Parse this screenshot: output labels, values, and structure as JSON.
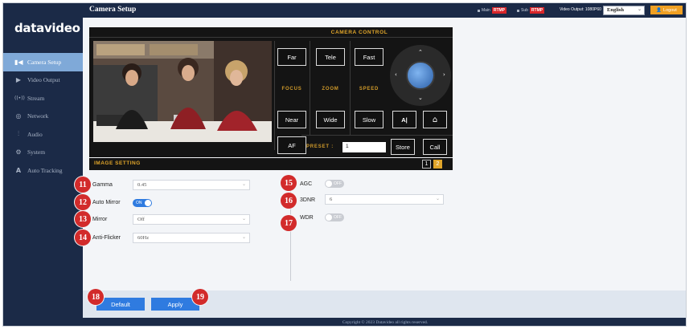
{
  "brand": {
    "logo_text": "datavideo"
  },
  "sidebar": {
    "items": [
      {
        "icon": "camera-icon",
        "glyph": "▮◀",
        "label": "Camera Setup",
        "active": true
      },
      {
        "icon": "video-output-icon",
        "glyph": "▶",
        "label": "Video Output",
        "active": false
      },
      {
        "icon": "stream-icon",
        "glyph": "((•))",
        "label": "Stream",
        "active": false
      },
      {
        "icon": "network-icon",
        "glyph": "◎",
        "label": "Network",
        "active": false
      },
      {
        "icon": "audio-icon",
        "glyph": "⫶",
        "label": "Audio",
        "active": false
      },
      {
        "icon": "system-icon",
        "glyph": "⚙",
        "label": "System",
        "active": false
      },
      {
        "icon": "auto-tracking-icon",
        "glyph": "A",
        "label": "Auto Tracking",
        "active": false
      }
    ]
  },
  "header": {
    "title": "Camera Setup",
    "main_label": "Main",
    "main_badge": "RTMP",
    "sub_label": "Sub",
    "sub_badge": "RTMP",
    "video_output": "Video Output: 1080P60",
    "language": "English",
    "logout": "Logout"
  },
  "camera_control": {
    "title": "CAMERA CONTROL",
    "focus": {
      "far": "Far",
      "label": "FOCUS",
      "near": "Near"
    },
    "zoom": {
      "tele": "Tele",
      "label": "ZOOM",
      "wide": "Wide"
    },
    "speed": {
      "fast": "Fast",
      "label": "SPEED",
      "slow": "Slow"
    },
    "af": "AF",
    "auto_tracking": "A|",
    "home": "⌂",
    "preset_label": "PRESET :",
    "preset_value": "1",
    "store": "Store",
    "call": "Call"
  },
  "image_setting": {
    "title": "IMAGE SETTING",
    "pages": [
      "1",
      "2"
    ],
    "active_page": "2",
    "gamma": {
      "label": "Gamma",
      "value": "0.45"
    },
    "auto_mirror": {
      "label": "Auto Mirror",
      "state": "ON"
    },
    "mirror": {
      "label": "Mirror",
      "value": "Off"
    },
    "anti_flicker": {
      "label": "Anti-Flicker",
      "value": "60Hz"
    },
    "agc": {
      "label": "AGC",
      "state": "OFF"
    },
    "dnr": {
      "label": "3DNR",
      "value": "6"
    },
    "wdr": {
      "label": "WDR",
      "state": "OFF"
    }
  },
  "callouts": [
    "11",
    "12",
    "13",
    "14",
    "15",
    "16",
    "17",
    "18",
    "19"
  ],
  "actions": {
    "default": "Default",
    "apply": "Apply"
  },
  "footer": "Copyright © 2023 Datavideo all rights reserved.",
  "colors": {
    "navy": "#1b2a47",
    "accent_blue": "#2f7be0",
    "gold": "#e0a52a",
    "rtmp_red": "#d8262a",
    "callout_red": "#d22b2b",
    "logout_orange": "#f0a023"
  }
}
